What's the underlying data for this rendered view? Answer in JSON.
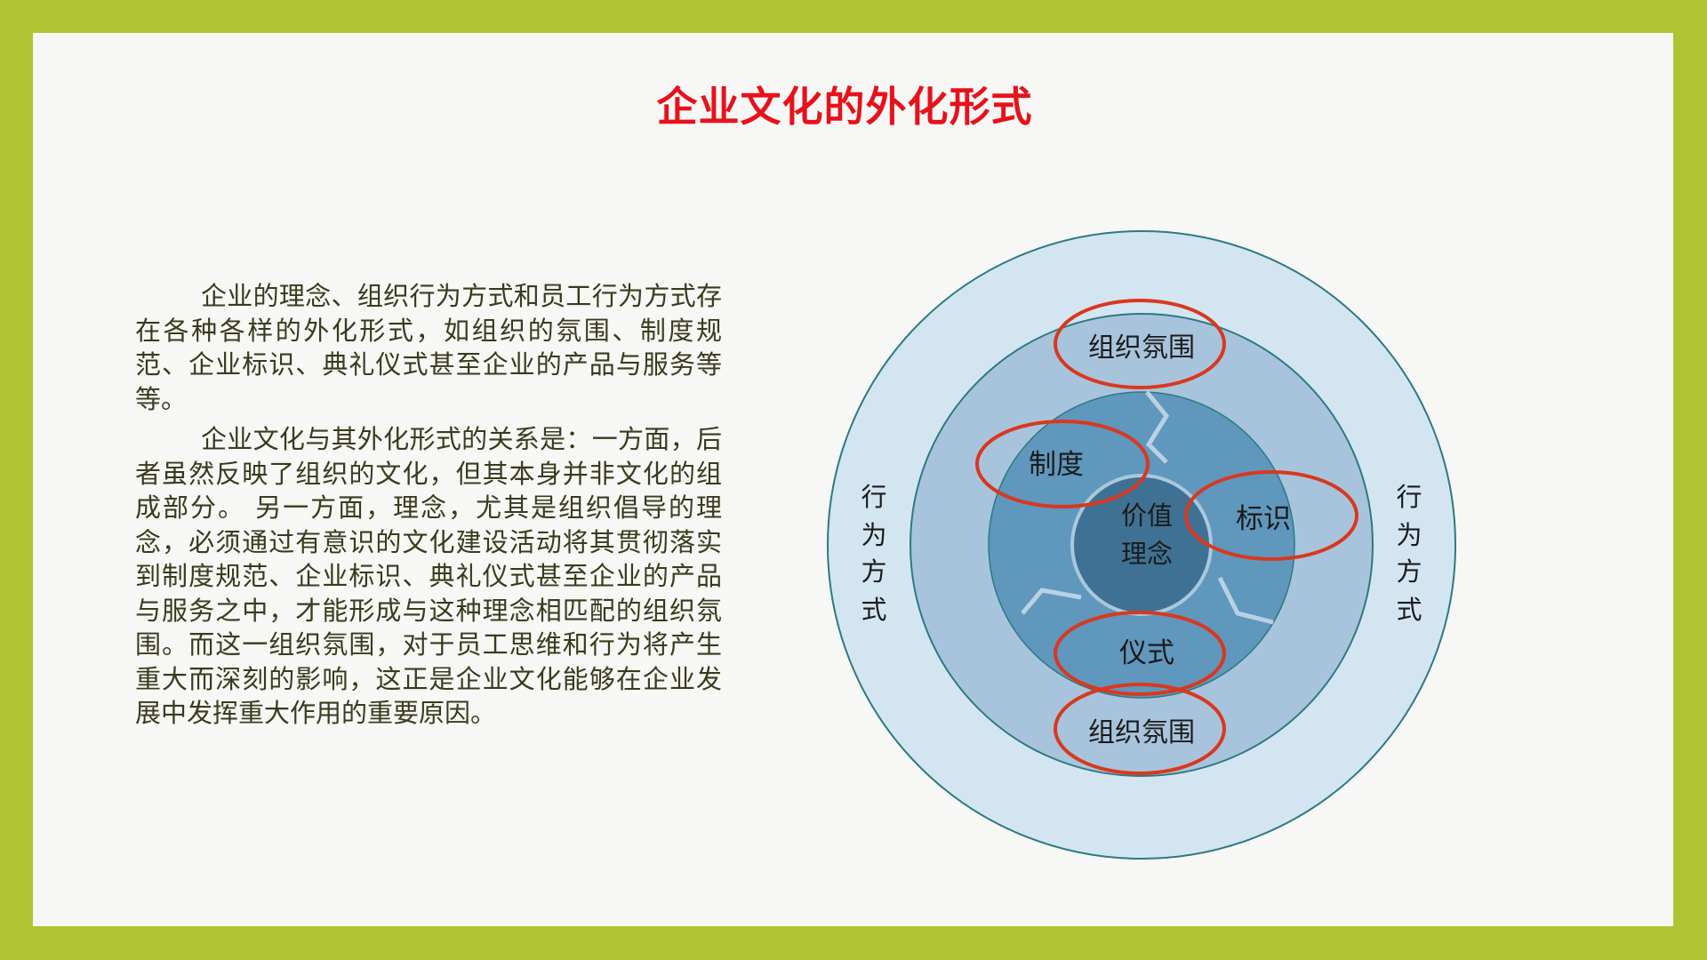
{
  "title": "企业文化的外化形式",
  "paragraphs": [
    "企业的理念、组织行为方式和员工行为方式存在各种各样的外化形式，如组织的氛围、制度规范、企业标识、典礼仪式甚至企业的产品与服务等等。",
    "企业文化与其外化形式的关系是：一方面，后者虽然反映了组织的文化，但其本身并非文化的组成部分。 另一方面，理念，尤其是组织倡导的理念，必须通过有意识的文化建设活动将其贯彻落实到制度规范、企业标识、典礼仪式甚至企业的产品与服务之中，才能形成与这种理念相匹配的组织氛围。而这一组织氛围，对于员工思维和行为将产生重大而深刻的影响，这正是企业文化能够在企业发展中发挥重大作用的重要原因。"
  ],
  "diagram": {
    "left_ring_label": [
      "行",
      "为",
      "方",
      "式"
    ],
    "right_ring_label": [
      "行",
      "为",
      "方",
      "式"
    ],
    "top_label": "组织氛围",
    "bottom_label": "组织氛围",
    "core_label": [
      "价值",
      "理念"
    ],
    "segment_labels": {
      "left": "制度",
      "right": "标识",
      "bottom": "仪式"
    },
    "colors": {
      "outer_ring": "#d4e5f2",
      "middle_ring": "#a8c4dc",
      "inner_ring": "#5f97bd",
      "core": "#3f7194",
      "highlight_oval": "#d9381e",
      "ring_stroke": "#2c7a80"
    }
  }
}
